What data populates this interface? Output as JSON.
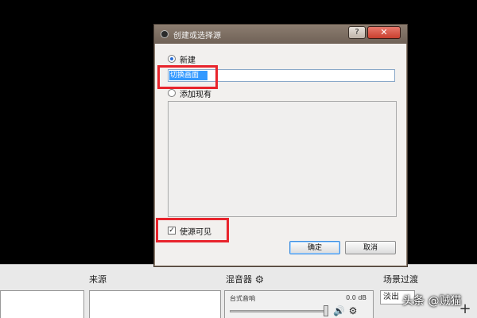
{
  "dialog": {
    "title": "创建或选择源",
    "help_label": "?",
    "close_label": "✕",
    "radio_new_label": "新建",
    "name_input_value": "切换画面",
    "radio_existing_label": "添加现有",
    "visible_checkbox_label": "使源可见",
    "visible_checked_mark": "✓",
    "ok_label": "确定",
    "cancel_label": "取消"
  },
  "dock": {
    "sources_title": "来源",
    "mixer_title": "混音器",
    "transition_title": "场景过渡",
    "mixer_channel_name": "台式音响",
    "mixer_channel_db": "0.0 dB",
    "transition_value": "淡出",
    "plus_label": "+",
    "gear_glyph": "⚙",
    "speaker_glyph": "🔊",
    "channel_gear_glyph": "⚙"
  },
  "watermark": "头条 @贼猫",
  "colors": {
    "highlight": "#e8242c",
    "selection": "#3399ff",
    "titlebar": "#7d6e62"
  }
}
